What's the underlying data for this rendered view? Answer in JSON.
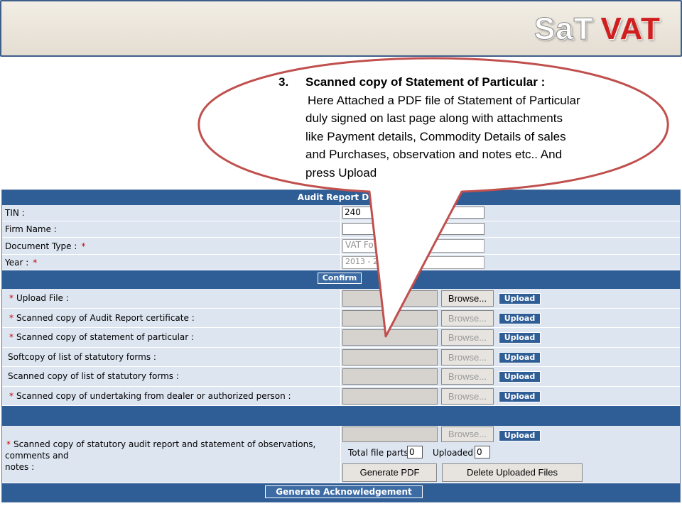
{
  "header": {
    "logo_part1": "SaT",
    "logo_part2": "VAT"
  },
  "colors": {
    "bar_blue": "#2f5d95",
    "row_bg": "#dde5f1",
    "required_star": "#cc0000",
    "callout_border": "#c0504d",
    "logo_red": "#d01f1f"
  },
  "callout": {
    "number": "3.",
    "title": "Scanned copy of Statement of Particular :",
    "body_lines": [
      "Here Attached a PDF file of Statement of Particular",
      "duly signed on last page along with attachments",
      "like Payment details, Commodity Details of sales",
      "and Purchases, observation and notes etc.. And",
      "press Upload"
    ]
  },
  "form": {
    "section_title": "Audit Report Deta",
    "tin_label": "TIN :",
    "tin_value": "240",
    "firm_label": "Firm Name :",
    "firm_value": "",
    "doc_type_label": "Document Type :",
    "doc_type_value": "VAT Fo",
    "year_label": "Year :",
    "year_value": "2013 - 20",
    "required_mark": "*",
    "confirm_label": "Confirm",
    "browse_label": "Browse...",
    "upload_label": "Upload",
    "upload_rows": [
      {
        "label": "Upload File :",
        "required": true,
        "browse_enabled": true
      },
      {
        "label": "Scanned copy of Audit Report certificate :",
        "required": true,
        "browse_enabled": false
      },
      {
        "label": "Scanned copy of statement of particular :",
        "required": true,
        "browse_enabled": false
      },
      {
        "label": "Softcopy of list of statutory forms :",
        "required": false,
        "browse_enabled": false
      },
      {
        "label": "Scanned copy of list of statutory forms :",
        "required": false,
        "browse_enabled": false
      },
      {
        "label": "Scanned copy of undertaking from dealer or authorized person :",
        "required": true,
        "browse_enabled": false
      }
    ],
    "audit_row": {
      "label_line1": "Scanned copy of statutory audit report and statement of observations, comments and",
      "label_line2": "notes :",
      "total_parts_label": "Total file parts",
      "total_parts_value": "0",
      "uploaded_label": "Uploaded",
      "uploaded_value": "0",
      "generate_pdf_label": "Generate PDF",
      "delete_label": "Delete Uploaded Files"
    },
    "ack_label": "Generate Acknowledgement"
  }
}
